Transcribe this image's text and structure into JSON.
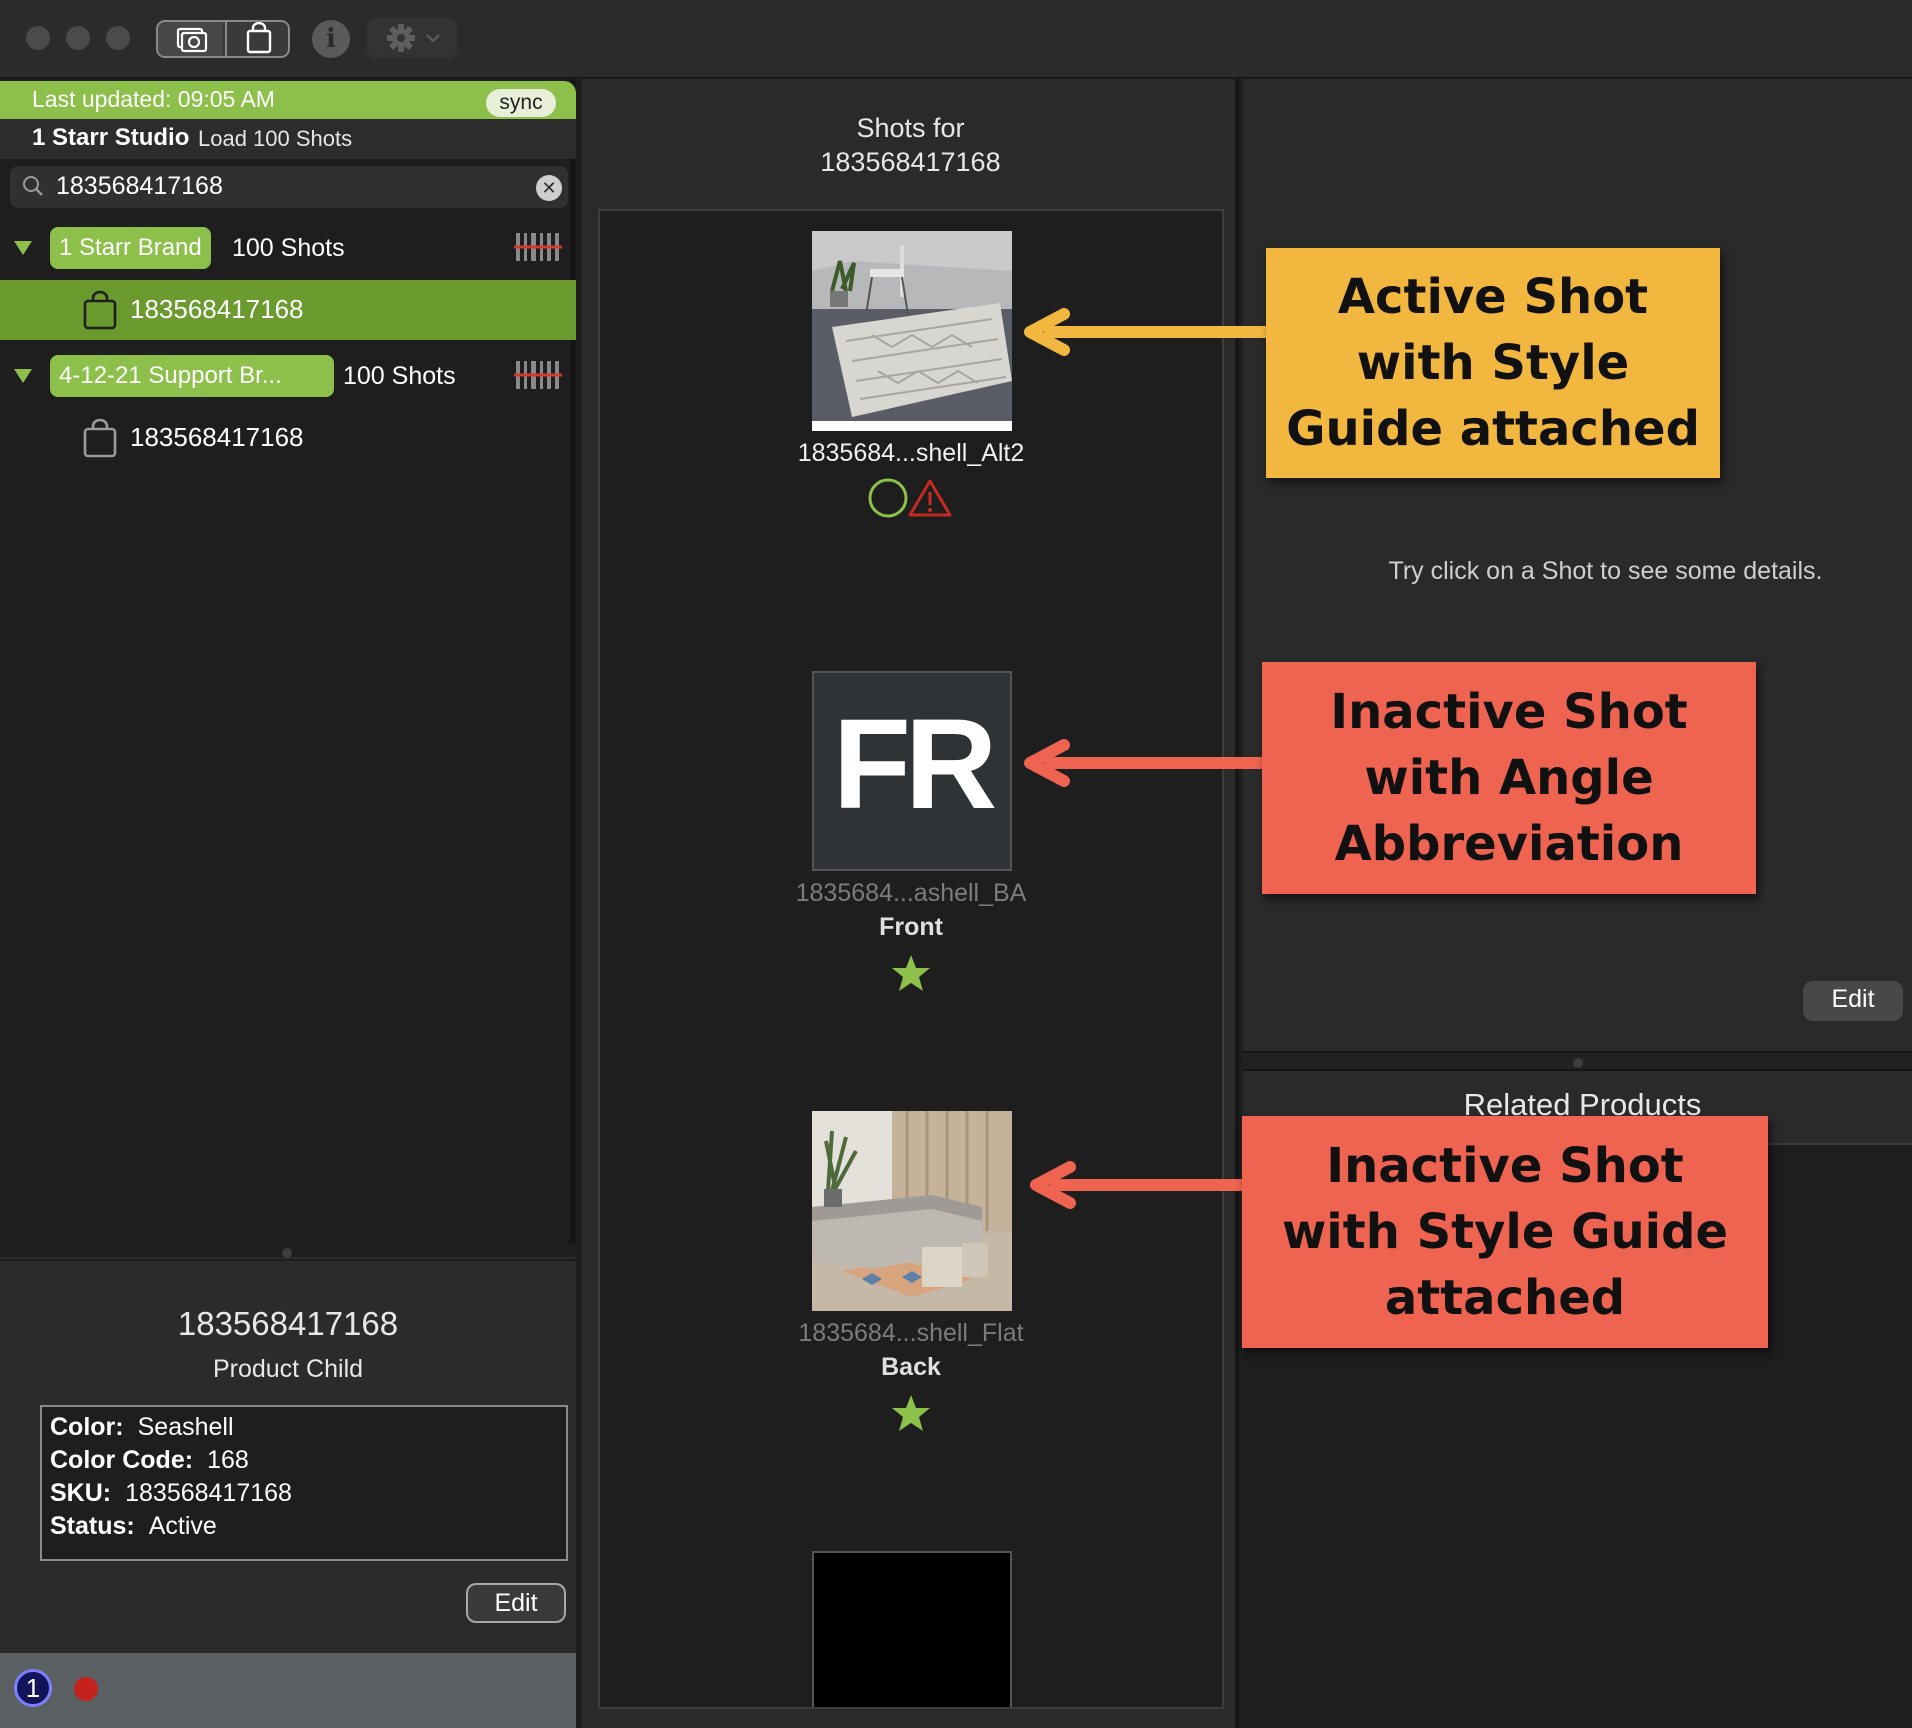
{
  "sidebar": {
    "last_updated": "Last updated: 09:05 AM",
    "sync_label": "sync",
    "studio_name": "1 Starr Studio",
    "load_label": "Load 100 Shots",
    "search_value": "183568417168",
    "brands": [
      {
        "name": "1 Starr Brand",
        "shots": "100 Shots",
        "child": "183568417168",
        "child_selected": true
      },
      {
        "name": "4-12-21 Support Br...",
        "shots": "100 Shots",
        "child": "183568417168",
        "child_selected": false
      }
    ],
    "detail": {
      "title": "183568417168",
      "subtitle": "Product Child",
      "props": [
        {
          "key": "Color:",
          "value": "Seashell"
        },
        {
          "key": "Color Code:",
          "value": "168"
        },
        {
          "key": "SKU:",
          "value": "183568417168"
        },
        {
          "key": "Status:",
          "value": "Active"
        }
      ],
      "edit_label": "Edit"
    },
    "status_badge": "1"
  },
  "middle": {
    "header_line1": "Shots for",
    "header_line2": "183568417168",
    "shots": [
      {
        "name": "1835684...shell_Alt2",
        "angle": "",
        "active": true,
        "icons": [
          "circle-icon",
          "warning-icon"
        ]
      },
      {
        "name": "1835684...ashell_BA",
        "angle": "Front",
        "active": false,
        "abbreviation": "FR",
        "icons": [
          "star-icon"
        ]
      },
      {
        "name": "1835684...shell_Flat",
        "angle": "Back",
        "active": false,
        "icons": [
          "star-icon"
        ]
      }
    ]
  },
  "right": {
    "hint": "Try click on a Shot to see some details.",
    "edit_label": "Edit",
    "related_title": "Related Products"
  },
  "callouts": {
    "active": [
      "Active Shot",
      "with Style",
      "Guide attached"
    ],
    "inactive_angle": [
      "Inactive Shot",
      "with Angle",
      "Abbreviation"
    ],
    "inactive_style": [
      "Inactive Shot",
      "with Style Guide",
      "attached"
    ]
  },
  "colors": {
    "accent_green": "#8dc04a",
    "selected_green": "#6b9a2e",
    "callout_yellow": "#f2b73e",
    "callout_red": "#ef6351",
    "arrow_yellow": "#f2b73e",
    "arrow_red": "#ef6351"
  }
}
